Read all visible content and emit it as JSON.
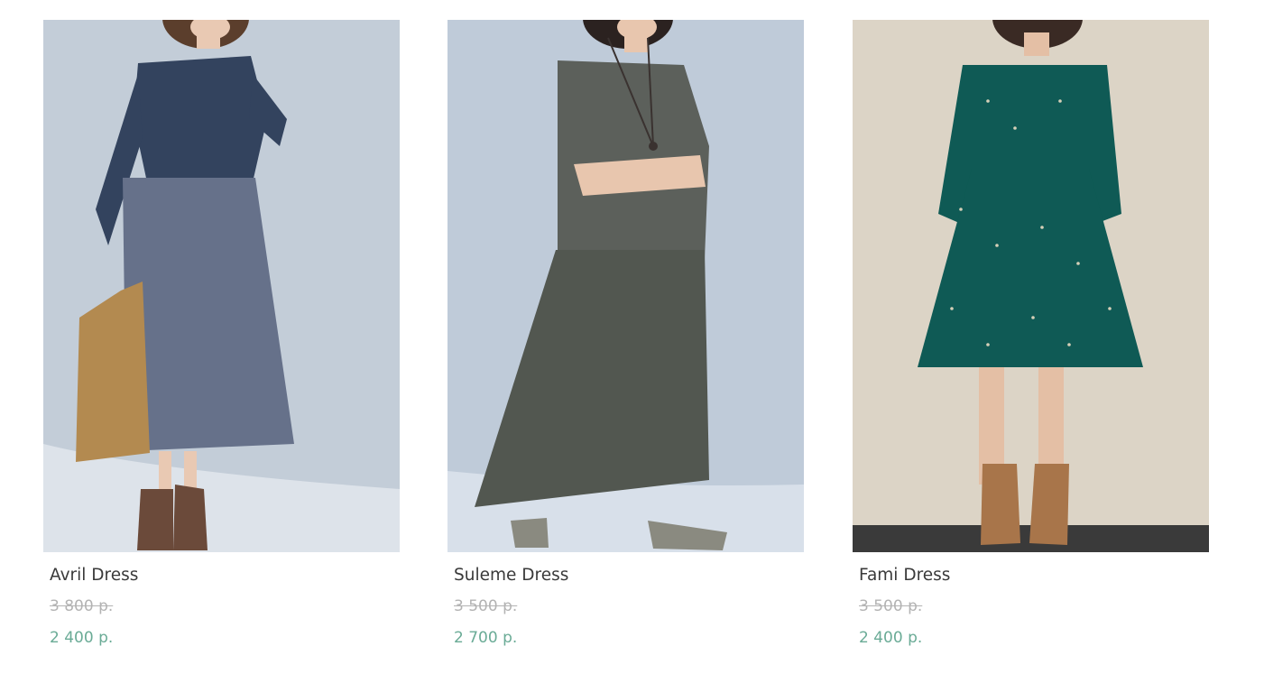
{
  "products": [
    {
      "name": "Avril Dress",
      "old_price": "3 800 р.",
      "price": "2 400 р.",
      "image": {
        "background": "#c3cdd8",
        "floor": "#dde3ea",
        "bodice": "#33435e",
        "skirt": "#66718a",
        "skin": "#e9c9b3",
        "hair": "#5b3e2c",
        "accessory": "#b38a50",
        "boots": "#6b4a3a"
      }
    },
    {
      "name": "Suleme Dress",
      "old_price": "3 500 р.",
      "price": "2 700 р.",
      "image": {
        "background": "#bfcbd9",
        "floor": "#d8e0ea",
        "bodice": "#5c605b",
        "skirt": "#525750",
        "skin": "#e8c6ae",
        "hair": "#2b2220",
        "accessory": "#3a3230",
        "boots": "#8a8a80"
      }
    },
    {
      "name": "Fami Dress",
      "old_price": "3 500 р.",
      "price": "2 400 р.",
      "image": {
        "background": "#dcd4c6",
        "floor": "#3a3a3a",
        "bodice": "#0f5a55",
        "skirt": "#0f5a55",
        "skin": "#e4bfa5",
        "hair": "#3a2a24",
        "accessory": "#d6d0b8",
        "boots": "#a8754a"
      }
    }
  ]
}
